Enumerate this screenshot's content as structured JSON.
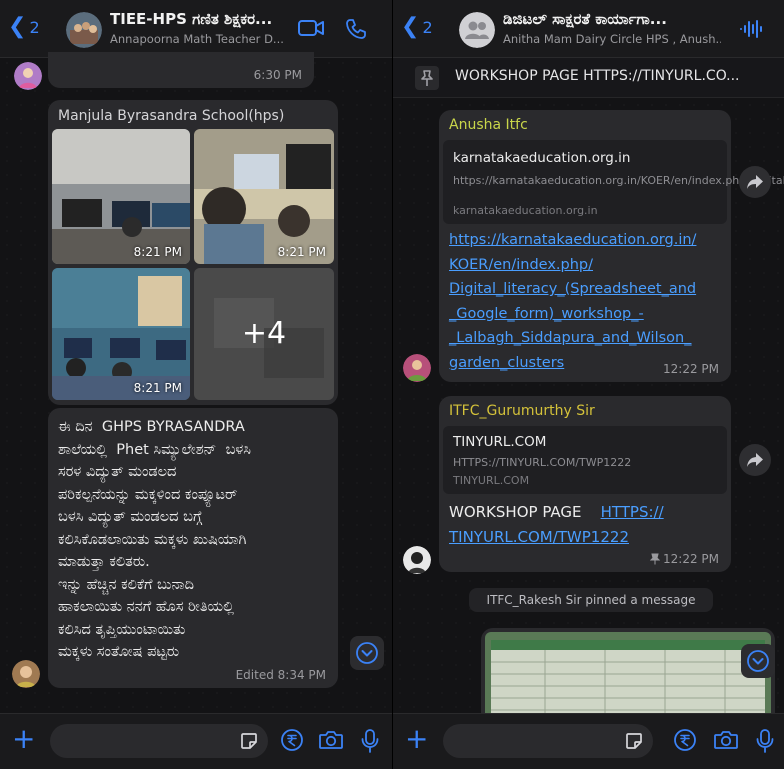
{
  "left": {
    "header": {
      "back_count": "2",
      "title": "TIEE-HPS ಗಣಿತ ಶಿಕ್ಷಕರ...",
      "subtitle": "Annapoorna Math Teacher D..."
    },
    "prev_bubble": {
      "time": "6:30 PM"
    },
    "media_msg": {
      "sender": "Manjula Byrasandra School(hps)",
      "photos": [
        {
          "time": "8:21 PM"
        },
        {
          "time": "8:21 PM"
        },
        {
          "time": "8:21 PM"
        }
      ],
      "more_count": "+4"
    },
    "text_msg": {
      "text": "ಈ ದಿನ  GHPS BYRASANDRA\nಶಾಲೆಯಲ್ಲಿ  Phet ಸಿಮ್ಯುಲೇಶನ್  ಬಳಸಿ\nಸರಳ ವಿದ್ಯುತ್ ಮಂಡಲದ\nಪರಿಕಲ್ಪನೆಯನ್ನು ಮಕ್ಕಳಿಂದ ಕಂಪ್ಯೂಟರ್\nಬಳಸಿ ವಿದ್ಯುತ್ ಮಂಡಲದ ಬಗ್ಗೆ\nಕಲಿಸಿಕೊಡಲಾಯಿತು ಮಕ್ಕಳು ಖುಷಿಯಾಗಿ\nಮಾಡುತ್ತಾ ಕಲಿತರು.\nಇನ್ನು ಹೆಚ್ಚಿನ ಕಲಿಕೆಗೆ ಬುನಾದಿ\nಹಾಕಲಾಯಿತು ನನಗೆ ಹೊಸ ರೀತಿಯಲ್ಲಿ\nಕಲಿಸಿದ ತೃಪ್ತಿಯುಂಟಾಯಿತು\nಮಕ್ಕಳು ಸಂತೋಷ ಪಟ್ಟರು",
      "edited": "Edited 8:34 PM"
    }
  },
  "right": {
    "header": {
      "back_count": "2",
      "title": "ಡಿಜಿಟಲ್ ಸಾಕ್ಷರತೆ ಕಾರ್ಯಾಗಾ...",
      "subtitle": "Anitha Mam Dairy Circle HPS , Anush..."
    },
    "pinned": {
      "text": "WORKSHOP PAGE    HTTPS://TINYURL.CO..."
    },
    "msg1": {
      "sender": "Anusha Itfc",
      "preview_title": "karnatakaeducation.org.in",
      "preview_desc": "https://karnatakaeducation.org.in/KOER/en/index.php/Digital_literacy_(Spreadsheet_an...",
      "preview_site": "karnatakaeducation.org.in",
      "link": "https://karnatakaeducation.org.in/KOER/en/index.php/Digital_literacy_(Spreadsheet_and_Google_form)_workshop_-_Lalbagh_Siddapura_and_Wilson_garden_clusters",
      "link_lines": [
        "https://karnatakaeducation.org.in/",
        "KOER/en/index.php/",
        "Digital_literacy_(Spreadsheet_and",
        "_Google_form)_workshop_-",
        "_Lalbagh_Siddapura_and_Wilson_",
        "garden_clusters"
      ],
      "time": "12:22 PM"
    },
    "msg2": {
      "sender": "ITFC_Gurumurthy Sir",
      "preview_title": "TINYURL.COM",
      "preview_desc": "HTTPS://TINYURL.COM/TWP1222",
      "preview_site": "TINYURL.COM",
      "text_prefix": "WORKSHOP PAGE",
      "link_lines": [
        "HTTPS://",
        "TINYURL.COM/TWP1222"
      ],
      "time": "12:22 PM"
    },
    "system": {
      "pinned_note": "ITFC_Rakesh Sir pinned a message"
    }
  },
  "colors": {
    "accent": "#3b82f6",
    "link": "#4a9eff",
    "sender_green": "#c9d64a",
    "sender_yellow": "#d4c23a",
    "bubble": "#2a2a2d",
    "background": "#131315"
  },
  "icons": {
    "left_header": [
      "chevron-left-icon",
      "video-call-icon",
      "phone-call-icon"
    ],
    "right_header": [
      "chevron-left-icon",
      "group-avatar-icon",
      "audio-waves-icon"
    ],
    "composer": [
      "plus-icon",
      "sticker-icon",
      "rupee-icon",
      "camera-icon",
      "microphone-icon"
    ]
  }
}
